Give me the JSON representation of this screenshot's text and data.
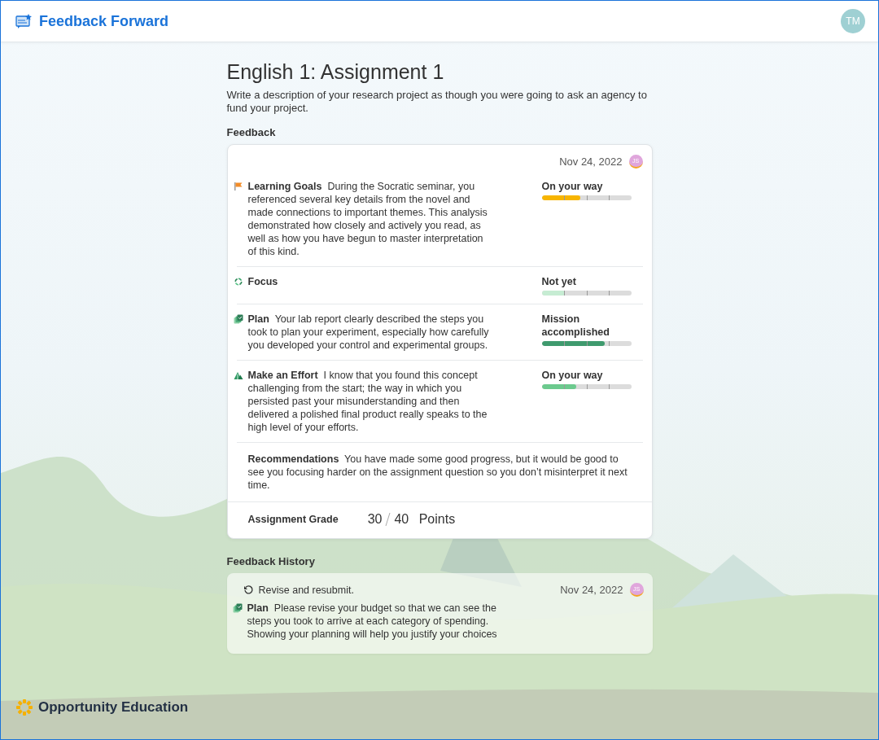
{
  "header": {
    "app_name": "Feedback Forward",
    "user_initials": "TM"
  },
  "assignment": {
    "title": "English 1: Assignment 1",
    "description": "Write a description of your research project as though you were going to ask an agency to fund your project."
  },
  "feedback": {
    "heading": "Feedback",
    "date": "Nov 24, 2022",
    "author_initials": "JS",
    "criteria": [
      {
        "kind": "flag",
        "name": "Learning Goals",
        "comment": "During the Socratic seminar, you referenced several key details from the novel and made connections to important themes. This analysis demonstrated how closely and actively you read, as well as how you have begun to master interpretation of this kind.",
        "rating": "On your way",
        "level": 0.43,
        "color": "#f7b500"
      },
      {
        "kind": "cycle",
        "name": "Focus",
        "rating": "Not yet",
        "level": 0.26,
        "color": "#c6ecd3"
      },
      {
        "kind": "cards",
        "name": "Plan",
        "comment": "Your lab report clearly described the steps you took to plan your experiment, especially how carefully you developed your control and experimental groups.",
        "rating": "Mission accomplished",
        "level": 0.7,
        "color": "#3f9a6e"
      },
      {
        "kind": "peaks",
        "name": "Make an Effort",
        "comment": "I know that you found this concept challenging from the start; the way in which you persisted past your misunderstanding and then delivered a polished final product really speaks to the high level of your efforts.",
        "rating": "On your way",
        "level": 0.39,
        "color": "#6cca8e"
      }
    ],
    "recommendations": {
      "label": "Recommendations",
      "text": "You have made some good progress, but it would be good to see you focusing harder on the assignment question so you don’t misinterpret it next time."
    },
    "grade": {
      "label": "Assignment Grade",
      "score": "30",
      "total": "40",
      "unit": "Points"
    }
  },
  "history": {
    "heading": "Feedback History",
    "entries": [
      {
        "status": "Revise and resubmit.",
        "date": "Nov 24, 2022",
        "author_initials": "JS",
        "kind": "cards",
        "name": "Plan",
        "comment": "Please revise your budget so that we can see the steps you took to arrive at each category of spending. Showing your planning will help you justify your choices"
      }
    ]
  },
  "footer": {
    "brand": "Opportunity Education"
  }
}
